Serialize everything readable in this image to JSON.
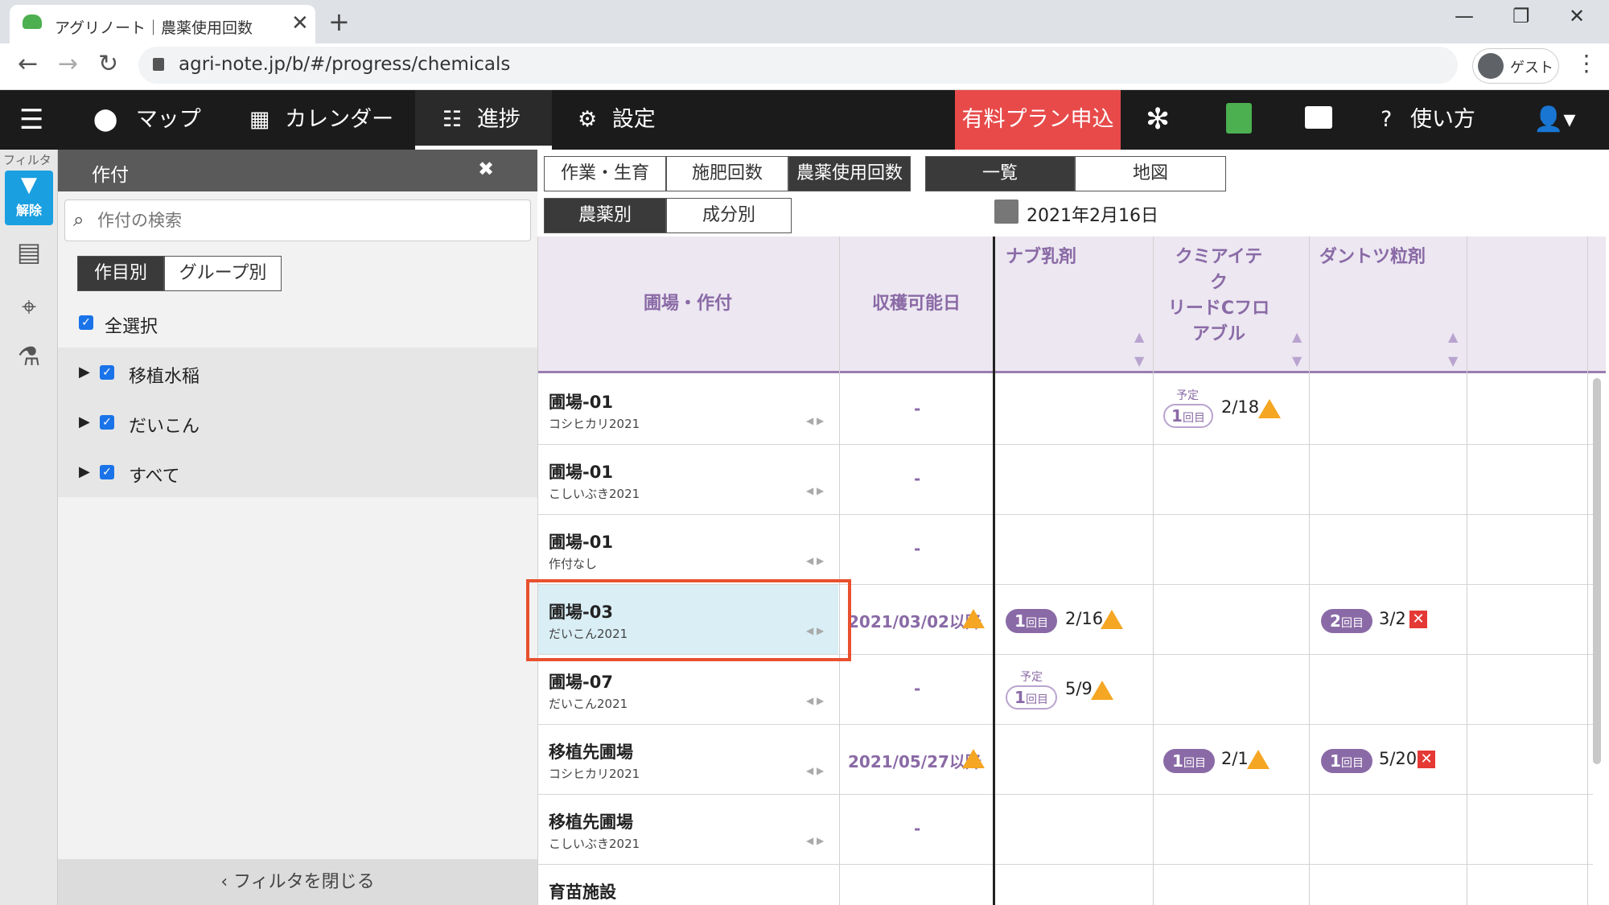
{
  "browser": {
    "tab_title": "アグリノート｜農薬使用回数",
    "tab_close": "✕",
    "new_tab": "+",
    "url": "agri-note.jp/b/#/progress/chemicals",
    "profile_label": "ゲスト",
    "minimize": "—",
    "restore": "❐",
    "close": "✕"
  },
  "nav": {
    "map": "マップ",
    "calendar": "カレンダー",
    "progress": "進捗",
    "settings": "設定",
    "paid_plan": "有料プラン申込",
    "help": "使い方"
  },
  "rail": {
    "filter_label": "フィルタ",
    "filter_button": "解除"
  },
  "filter_panel": {
    "title": "作付",
    "close_x": "✖",
    "search_placeholder": "作付の検索",
    "seg_by_item": "作目別",
    "seg_by_group": "グループ別",
    "select_all": "全選択",
    "items": [
      {
        "label": "移植水稲"
      },
      {
        "label": "だいこん"
      },
      {
        "label": "すべて"
      }
    ],
    "close_filter": "フィルタを閉じる"
  },
  "main": {
    "tabs": [
      "作業・生育",
      "施肥回数",
      "農薬使用回数"
    ],
    "view_tabs": [
      "一覧",
      "地図"
    ],
    "sub_tabs": [
      "農薬別",
      "成分別"
    ],
    "date": "2021年2月16日",
    "headers": {
      "field": "圃場・作付",
      "harvest": "収穫可能日",
      "chem1": "ナブ乳剤",
      "chem2_l1": "クミアイテク",
      "chem2_l2": "リードCフロ",
      "chem2_l3": "アブル",
      "chem3": "ダントツ粒剤"
    },
    "rows": [
      {
        "field": "圃場-01",
        "crop": "コシヒカリ2021",
        "harvest": "-"
      },
      {
        "field": "圃場-01",
        "crop": "こしいぶき2021",
        "harvest": "-"
      },
      {
        "field": "圃場-01",
        "crop": "作付なし",
        "harvest": "-"
      },
      {
        "field": "圃場-03",
        "crop": "だいこん2021",
        "harvest": "2021/03/02以降"
      },
      {
        "field": "圃場-07",
        "crop": "だいこん2021",
        "harvest": "-"
      },
      {
        "field": "移植先圃場",
        "crop": "コシヒカリ2021",
        "harvest": "2021/05/27以降"
      },
      {
        "field": "移植先圃場",
        "crop": "こしいぶき2021",
        "harvest": "-"
      },
      {
        "field": "育苗施設",
        "crop": "",
        "harvest": ""
      }
    ],
    "cells": {
      "r1_chem2_plan": "予定",
      "r1_chem2_count": "1",
      "r1_chem2_unit": "回目",
      "r1_chem2_date": "2/18",
      "r4_chem1_count": "1",
      "r4_chem1_unit": "回目",
      "r4_chem1_date": "2/16",
      "r4_chem3_count": "2",
      "r4_chem3_unit": "回目",
      "r4_chem3_date": "3/2",
      "r5_chem1_plan": "予定",
      "r5_chem1_count": "1",
      "r5_chem1_unit": "回目",
      "r5_chem1_date": "5/9",
      "r6_chem2_count": "1",
      "r6_chem2_unit": "回目",
      "r6_chem2_date": "2/1",
      "r6_chem3_count": "1",
      "r6_chem3_unit": "回目",
      "r6_chem3_date": "5/20",
      "cross": "✕",
      "warn": "!"
    },
    "sort_up": "▲",
    "sort_down": "▼",
    "row_arrows": "◀ ▶"
  }
}
